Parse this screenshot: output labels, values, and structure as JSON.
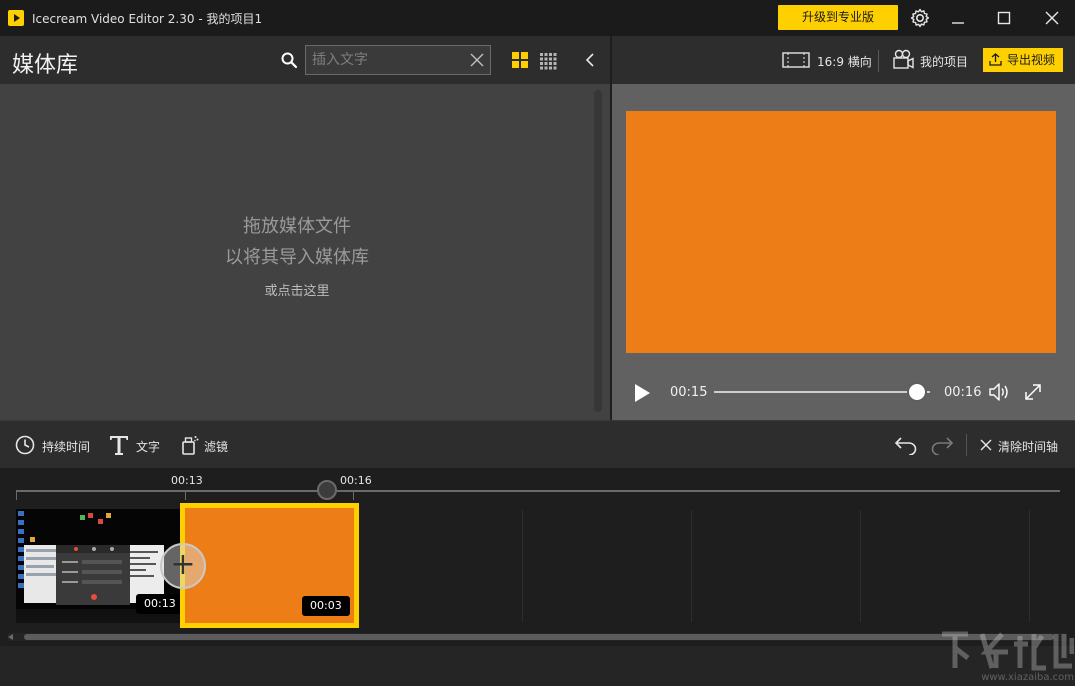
{
  "window": {
    "title": "Icecream Video Editor 2.30 - 我的项目1",
    "upgrade_label": "升级到专业版",
    "icons": [
      "app-logo-icon",
      "gear-icon",
      "minimize-icon",
      "maximize-icon",
      "close-icon"
    ]
  },
  "media": {
    "title": "媒体库",
    "search_placeholder": "插入文字",
    "empty_line1": "拖放媒体文件",
    "empty_line2": "以将其导入媒体库",
    "empty_link": "或点击这里"
  },
  "preview": {
    "aspect_label": "16:9 横向",
    "projects_label": "我的项目",
    "export_label": "导出视频",
    "current_time": "00:15",
    "total_time": "00:16",
    "progress_fraction": 0.94,
    "frame_color": "#ED7E17"
  },
  "toolbar": {
    "duration_label": "持续时间",
    "text_label": "文字",
    "filter_label": "滤镜",
    "clear_timeline_label": "清除时间轴"
  },
  "timeline": {
    "ticks": [
      "00:13",
      "00:16"
    ],
    "clips": [
      {
        "type": "screenshot",
        "duration": "00:13"
      },
      {
        "type": "color",
        "duration": "00:03",
        "color": "#ED7E17",
        "selected": true
      }
    ]
  },
  "colors": {
    "accent": "#FFD000",
    "clip_orange": "#ED7E17"
  },
  "watermark": {
    "url": "www.xiazaiba.com"
  }
}
